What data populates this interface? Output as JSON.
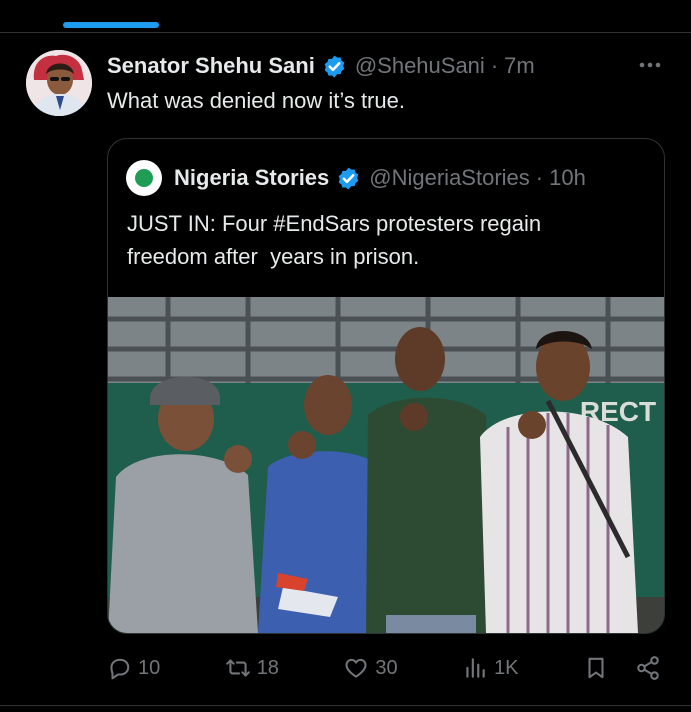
{
  "tweet": {
    "author_name": "Senator Shehu Sani",
    "handle": "@ShehuSani",
    "separator": "·",
    "time": "7m",
    "text": "What was denied now it’s true."
  },
  "quoted_tweet": {
    "author_name": "Nigeria Stories",
    "handle": "@NigeriaStories",
    "separator": "·",
    "time": "10h",
    "text": "JUST IN: Four #EndSars protesters regain\nfreedom after  years in prison.",
    "photo_sign_text": "RECT"
  },
  "actions": {
    "replies": "10",
    "retweets": "18",
    "likes": "30",
    "views": "1K"
  },
  "icons": {
    "verified": "verified-badge-icon",
    "more": "more-icon",
    "reply": "reply-icon",
    "retweet": "retweet-icon",
    "like": "heart-icon",
    "views": "views-icon",
    "bookmark": "bookmark-icon",
    "share": "share-icon"
  },
  "colors": {
    "accent": "#1d9bf0",
    "muted": "#71767b",
    "text": "#e7e9ea",
    "background": "#000000"
  }
}
